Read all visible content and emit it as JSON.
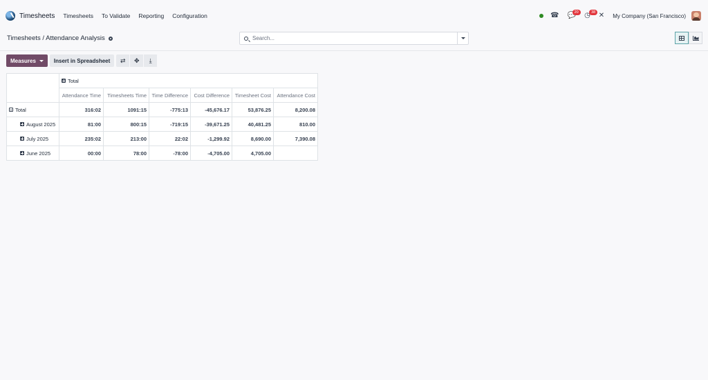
{
  "navbar": {
    "app_name": "Timesheets",
    "menu": [
      "Timesheets",
      "To Validate",
      "Reporting",
      "Configuration"
    ],
    "phone_badge": "",
    "messages_badge": "20",
    "activities_badge": "38",
    "company": "My Company (San Francisco)"
  },
  "control_panel": {
    "breadcrumb": "Timesheets / Attendance Analysis",
    "search_placeholder": "Search..."
  },
  "toolbar": {
    "measures_label": "Measures",
    "spreadsheet_label": "Insert in Spreadsheet"
  },
  "pivot": {
    "column_header": "Total",
    "measures": [
      "Attendance Time",
      "Timesheets Time",
      "Time Difference",
      "Cost Difference",
      "Timesheet Cost",
      "Attendance Cost"
    ],
    "rows": [
      {
        "label": "Total",
        "values": [
          "316:02",
          "1091:15",
          "-775:13",
          "-45,676.17",
          "53,876.25",
          "8,200.08"
        ]
      },
      {
        "label": "August 2025",
        "values": [
          "81:00",
          "800:15",
          "-719:15",
          "-39,671.25",
          "40,481.25",
          "810.00"
        ]
      },
      {
        "label": "July 2025",
        "values": [
          "235:02",
          "213:00",
          "22:02",
          "-1,299.92",
          "8,690.00",
          "7,390.08"
        ]
      },
      {
        "label": "June 2025",
        "values": [
          "00:00",
          "78:00",
          "-78:00",
          "-4,705.00",
          "4,705.00",
          ""
        ]
      }
    ]
  },
  "colors": {
    "primary": "#714b67",
    "presence": "#2e8b22",
    "badge": "#e2353c"
  }
}
